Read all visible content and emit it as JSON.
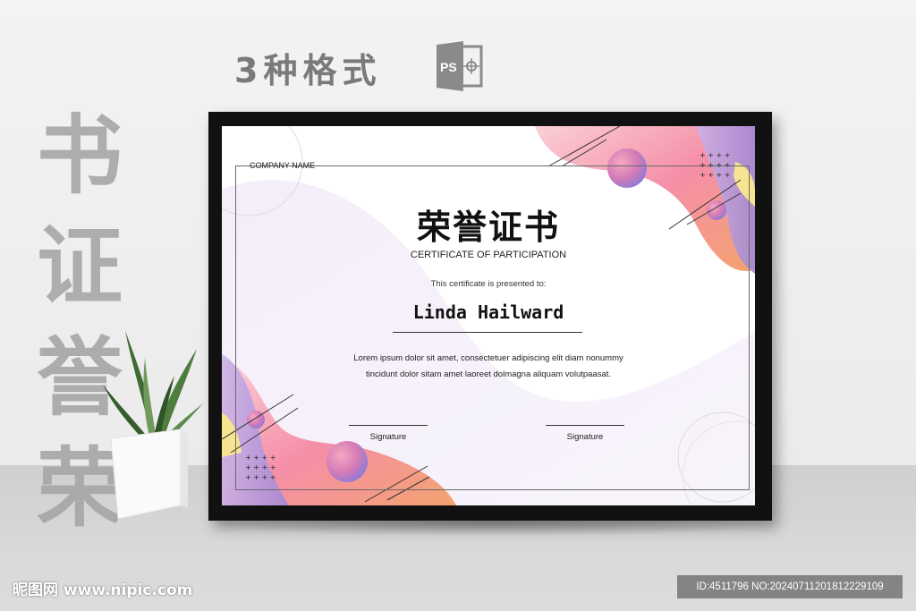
{
  "headline": {
    "format_label": "3种格式",
    "format_icon": "photoshop-file-icon",
    "format_icon_text": "PS"
  },
  "vertical_title": [
    "书",
    "证",
    "誉",
    "荣"
  ],
  "certificate": {
    "company": "COMPANY NAME",
    "title": "荣誉证书",
    "subtitle": "CERTIFICATE OF PARTICIPATION",
    "presented": "This certificate is presented to:",
    "recipient": "Linda Hailward",
    "body_line1": "Lorem ipsum dolor sit amet, consectetuer adipiscing elit diam nonummy",
    "body_line2": "tincidunt dolor sitam amet laoreet dolmagna aliquam volutpaasat.",
    "signature_left": "Signature",
    "signature_right": "Signature"
  },
  "watermark": {
    "site": "昵图网 www.nipic.com",
    "id": "ID:4511796 NO:20240711201812229109"
  },
  "colors": {
    "frame": "#111111",
    "pink": "#f37ea0",
    "peach": "#f6b59a",
    "lavender": "#b9a4e0",
    "yellow": "#f6e58a",
    "text_gray": "#7a7a7a"
  }
}
